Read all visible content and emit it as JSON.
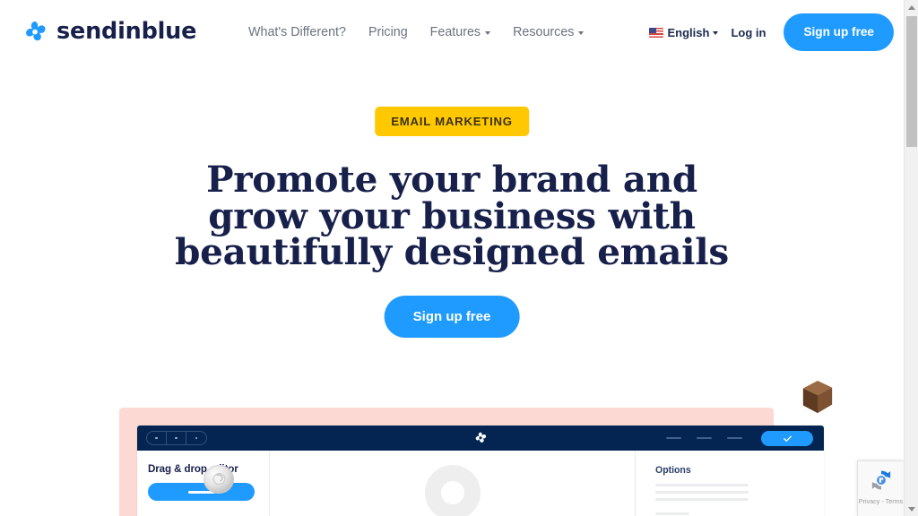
{
  "brand": {
    "name": "sendinblue",
    "logo_icon": "sendinblue-pinwheel-icon",
    "logo_color": "#1f9bff",
    "wordmark_color": "#17204a"
  },
  "nav": {
    "items": [
      {
        "label": "What's Different?",
        "has_dropdown": false
      },
      {
        "label": "Pricing",
        "has_dropdown": false
      },
      {
        "label": "Features",
        "has_dropdown": true
      },
      {
        "label": "Resources",
        "has_dropdown": true
      }
    ]
  },
  "header_right": {
    "language": {
      "label": "English",
      "flag_icon": "us-flag-icon",
      "has_dropdown": true
    },
    "login_label": "Log in",
    "signup_label": "Sign up free"
  },
  "hero": {
    "badge": "EMAIL MARKETING",
    "headline_lines": [
      "Promote your brand and",
      "grow your business with",
      "beautifully designed emails"
    ],
    "cta_label": "Sign up free",
    "badge_color": "#ffc800",
    "accent_color": "#1f9bff",
    "text_color": "#17204a"
  },
  "mockup": {
    "panel_color": "#fcd9d2",
    "toolbar_color": "#042552",
    "window_controls_icon": "window-segment-dots-icon",
    "toolbar_logo_icon": "sendinblue-pinwheel-icon",
    "toolbar_check_icon": "check-icon",
    "sidebar_title": "Drag & drop editor",
    "options_title": "Options",
    "decor_objects": [
      {
        "name": "3d-torus-object",
        "color": "#dedede"
      },
      {
        "name": "3d-wood-cube-object",
        "color": "#8b5e3c"
      }
    ]
  },
  "recaptcha": {
    "icon": "recaptcha-icon",
    "text": "Privacy - Terms"
  },
  "scrollbar": {
    "up_icon": "scroll-up-arrow-icon",
    "down_icon": "scroll-down-arrow-icon"
  }
}
